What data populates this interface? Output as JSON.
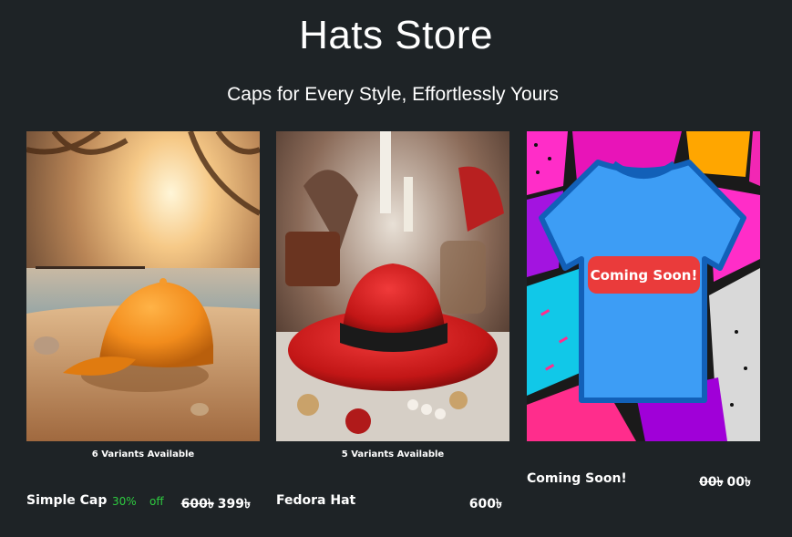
{
  "store": {
    "title": "Hats Store",
    "subtitle": "Caps for Every Style, Effortlessly Yours"
  },
  "products": [
    {
      "image_icon": "orange-cap-beach-image",
      "variants": "6 Variants Available",
      "name": "Simple Cap",
      "discount_percent": "30%",
      "discount_label": "off",
      "old_price": "600৳",
      "price": "399৳"
    },
    {
      "image_icon": "red-fedora-image",
      "variants": "5 Variants Available",
      "name": "Fedora Hat",
      "price": "600৳"
    },
    {
      "image_icon": "coming-soon-tshirt-image",
      "badge": "Coming Soon!",
      "name": "Coming Soon!",
      "old_price": "00৳",
      "price": "00৳"
    }
  ],
  "colors": {
    "background": "#1e2326",
    "discount": "#2ecc40",
    "badge": "#ea3b3b",
    "tshirt": "#3d9df5"
  }
}
